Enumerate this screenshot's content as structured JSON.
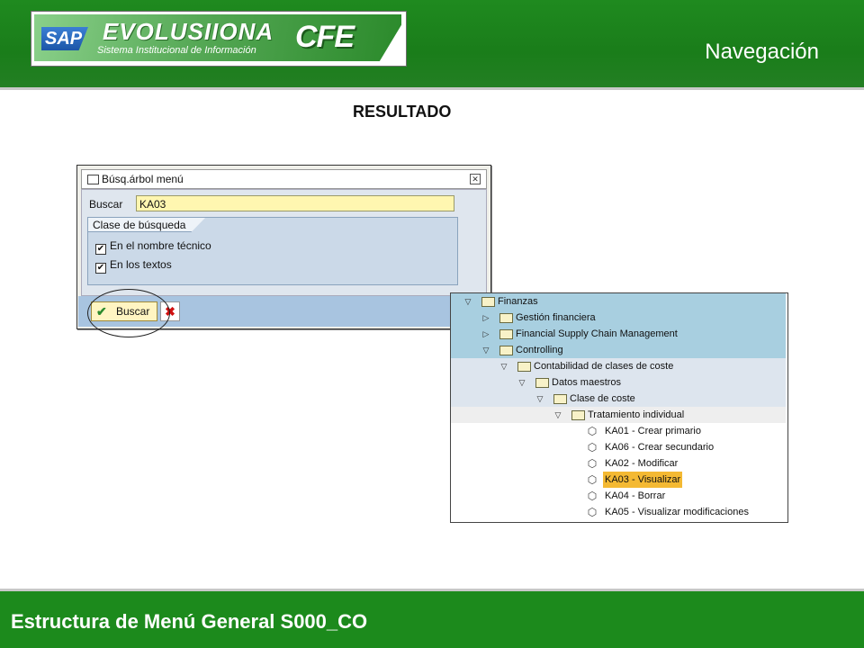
{
  "header": {
    "logo": {
      "sap": "SAP",
      "brand": "EVOLUSIIONA",
      "subtitle": "Sistema Institucional de Información",
      "cfe": "CFE"
    },
    "title": "Navegación"
  },
  "result_title": "RESULTADO",
  "dialog": {
    "window_title": "Búsq.árbol menú",
    "search_label": "Buscar",
    "search_value": "KA03",
    "group_title": "Clase de búsqueda",
    "options": [
      {
        "label": "En el nombre técnico",
        "checked": true
      },
      {
        "label": "En los textos",
        "checked": true
      }
    ],
    "search_button": "Buscar"
  },
  "tree": {
    "rows": [
      {
        "label": "Finanzas",
        "type": "folder",
        "expanded": true
      },
      {
        "label": "Gestión financiera",
        "type": "folder",
        "expanded": false
      },
      {
        "label": "Financial Supply Chain Management",
        "type": "folder",
        "expanded": false
      },
      {
        "label": "Controlling",
        "type": "folder",
        "expanded": true
      },
      {
        "label": "Contabilidad de clases de coste",
        "type": "folder",
        "expanded": true
      },
      {
        "label": "Datos maestros",
        "type": "folder",
        "expanded": true
      },
      {
        "label": "Clase de coste",
        "type": "folder",
        "expanded": true
      },
      {
        "label": "Tratamiento individual",
        "type": "folder",
        "expanded": true
      },
      {
        "label": "KA01 - Crear primario",
        "type": "transaction"
      },
      {
        "label": "KA06 - Crear secundario",
        "type": "transaction"
      },
      {
        "label": "KA02 - Modificar",
        "type": "transaction"
      },
      {
        "label": "KA03 - Visualizar",
        "type": "transaction",
        "highlighted": true
      },
      {
        "label": "KA04 - Borrar",
        "type": "transaction"
      },
      {
        "label": "KA05 - Visualizar modificaciones",
        "type": "transaction"
      }
    ]
  },
  "footer": {
    "title": "Estructura de Menú General  S000_CO"
  }
}
